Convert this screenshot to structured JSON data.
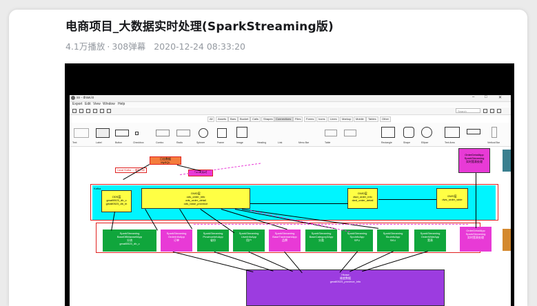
{
  "video": {
    "title": "电商项目_大数据实时处理(SparkStreaming版)",
    "plays": "4.1万播放",
    "separator": "·",
    "danmaku": "308弹幕",
    "date": "2020-12-24 08:33:20"
  },
  "diagram": {
    "window_title": "ss - draw.io",
    "menu": [
      "Export",
      "Edit",
      "View",
      "Window",
      "Help"
    ],
    "search_placeholder": "Search",
    "tabs": [
      "All",
      "Assets",
      "Bars",
      "Bucket",
      "Calls",
      "Shapes",
      "Connections",
      "Files",
      "Forms",
      "Icons",
      "Lines",
      "Markup",
      "Mobile",
      "Tables",
      "Other"
    ],
    "palette": [
      "Text",
      "Label",
      "Button",
      "Checkbox",
      "Combo",
      "Radio",
      "Spinner",
      "Frame",
      "Image",
      "Heading",
      "Link",
      "Menu Bar",
      "Table",
      "Rectangle",
      "Shape",
      "Ellipse",
      "Form",
      "Text Area",
      "Hover",
      "Vertical Bar"
    ],
    "canvas": {
      "top_orange": "日志数据\nMySQL",
      "top_pink": "Canal实时",
      "top_red_caption": "Canal+Kafka → 增量订阅",
      "frame_label": "Kafka",
      "ods_box": "ODS层\ngmall0523_db_c\ngmall0523_db_m",
      "dwd_box": "DWD层\nods_order_info\nods_order_detail\nods_base_province",
      "dwd2_box": "DWD层\ndwd_order_info\ndwd_order_detail",
      "dws_box": "DWS层\ndws_order_wide",
      "right_top_box": "OrderDetailApp\nSparkStreaming\n实时宽表处理",
      "apps": [
        "SparkStreaming\nBaseDBMaxwellApp\n分流\ngmall0523_db_c",
        "SparkStreaming\nOrderInfoApp\n订单",
        "SparkStreaming\nProvinceInfoApp\n省份",
        "SparkStreaming\nUserInfoApp\n用户",
        "SparkStreaming\nBaseTrademarkApp\n品牌",
        "SparkStreaming\nBaseCategory3App\n分类",
        "SparkStreaming\nSpuInfoApp\nSPU",
        "SparkStreaming\nSkuInfoApp\nSKU",
        "SparkStreaming\nOrderWideApp\n宽表"
      ],
      "hbase_box": "Hbase\n维度数据\ngmall0523_province_info"
    }
  }
}
